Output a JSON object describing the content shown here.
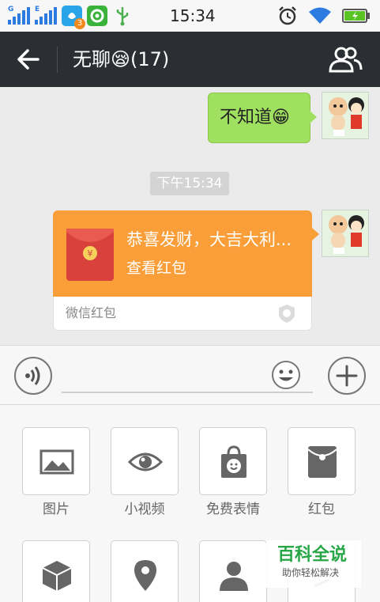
{
  "status_bar": {
    "time": "15:34",
    "network_badge": "3",
    "signal_1_tag": "G",
    "signal_2_tag": "E"
  },
  "header": {
    "title": "无聊😪(17)"
  },
  "messages": {
    "outgoing_text": "不知道😁",
    "time_divider": "下午15:34",
    "red_packet": {
      "title": "恭喜发财，大吉大利...",
      "action": "查看红包",
      "footer": "微信红包"
    }
  },
  "input": {
    "placeholder": ""
  },
  "panel": {
    "items": [
      {
        "label": "图片",
        "icon": "image-icon"
      },
      {
        "label": "小视频",
        "icon": "eye-icon"
      },
      {
        "label": "免费表情",
        "icon": "sticker-bag-icon"
      },
      {
        "label": "红包",
        "icon": "red-packet-icon"
      },
      {
        "label": "",
        "icon": "cube-icon"
      },
      {
        "label": "",
        "icon": "location-pin-icon"
      },
      {
        "label": "",
        "icon": "person-icon"
      },
      {
        "label": "",
        "icon": "more-icon"
      }
    ]
  },
  "watermark": {
    "brand": "百科全说",
    "tagline": "助你轻松解决"
  },
  "colors": {
    "title_bar": "#2b2f33",
    "outgoing_bubble": "#a0e060",
    "red_packet": "#f99e38",
    "watermark_green": "#27a745"
  }
}
